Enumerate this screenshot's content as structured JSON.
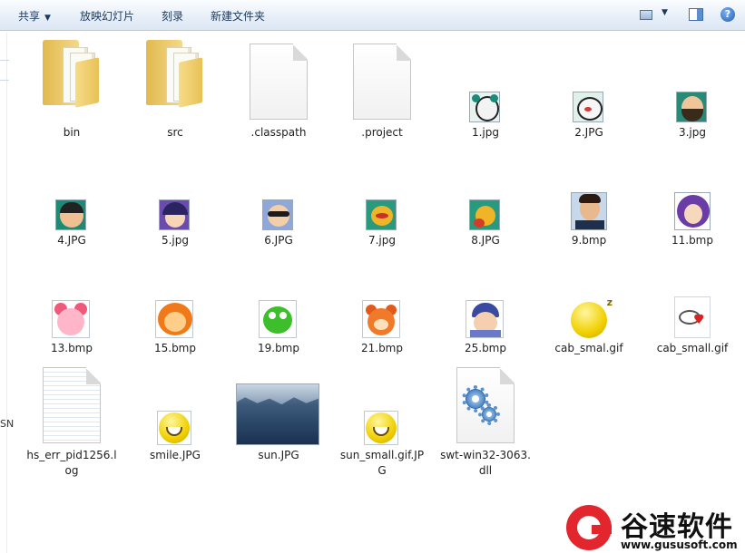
{
  "toolbar": {
    "share_label": "共享",
    "slideshow_label": "放映幻灯片",
    "burn_label": "刻录",
    "new_folder_label": "新建文件夹",
    "help_label": "?"
  },
  "left_fragment_text": "SN",
  "files": [
    {
      "name": "bin",
      "type": "folder"
    },
    {
      "name": "src",
      "type": "folder"
    },
    {
      "name": ".classpath",
      "type": "document"
    },
    {
      "name": ".project",
      "type": "document"
    },
    {
      "name": "1.jpg",
      "type": "image"
    },
    {
      "name": "2.JPG",
      "type": "image"
    },
    {
      "name": "3.jpg",
      "type": "image"
    },
    {
      "name": "4.JPG",
      "type": "image"
    },
    {
      "name": "5.jpg",
      "type": "image"
    },
    {
      "name": "6.JPG",
      "type": "image"
    },
    {
      "name": "7.jpg",
      "type": "image"
    },
    {
      "name": "8.JPG",
      "type": "image"
    },
    {
      "name": "9.bmp",
      "type": "image"
    },
    {
      "name": "11.bmp",
      "type": "image"
    },
    {
      "name": "13.bmp",
      "type": "image"
    },
    {
      "name": "15.bmp",
      "type": "image"
    },
    {
      "name": "19.bmp",
      "type": "image"
    },
    {
      "name": "21.bmp",
      "type": "image"
    },
    {
      "name": "25.bmp",
      "type": "image"
    },
    {
      "name": "cab_smal.gif",
      "type": "image"
    },
    {
      "name": "cab_small.gif",
      "type": "image"
    },
    {
      "name": "hs_err_pid1256.log",
      "type": "log"
    },
    {
      "name": "smile.JPG",
      "type": "image"
    },
    {
      "name": "sun.JPG",
      "type": "photo"
    },
    {
      "name": "sun_small.gif.JPG",
      "type": "image"
    },
    {
      "name": "swt-win32-3063.dll",
      "type": "dll"
    }
  ],
  "colors": {
    "toolbar_text": "#1e395b",
    "folder_yellow": "#f4d98a",
    "watermark_red": "#e3262e"
  },
  "watermark": {
    "title": "谷速软件",
    "url": "www.gususoft.com"
  }
}
